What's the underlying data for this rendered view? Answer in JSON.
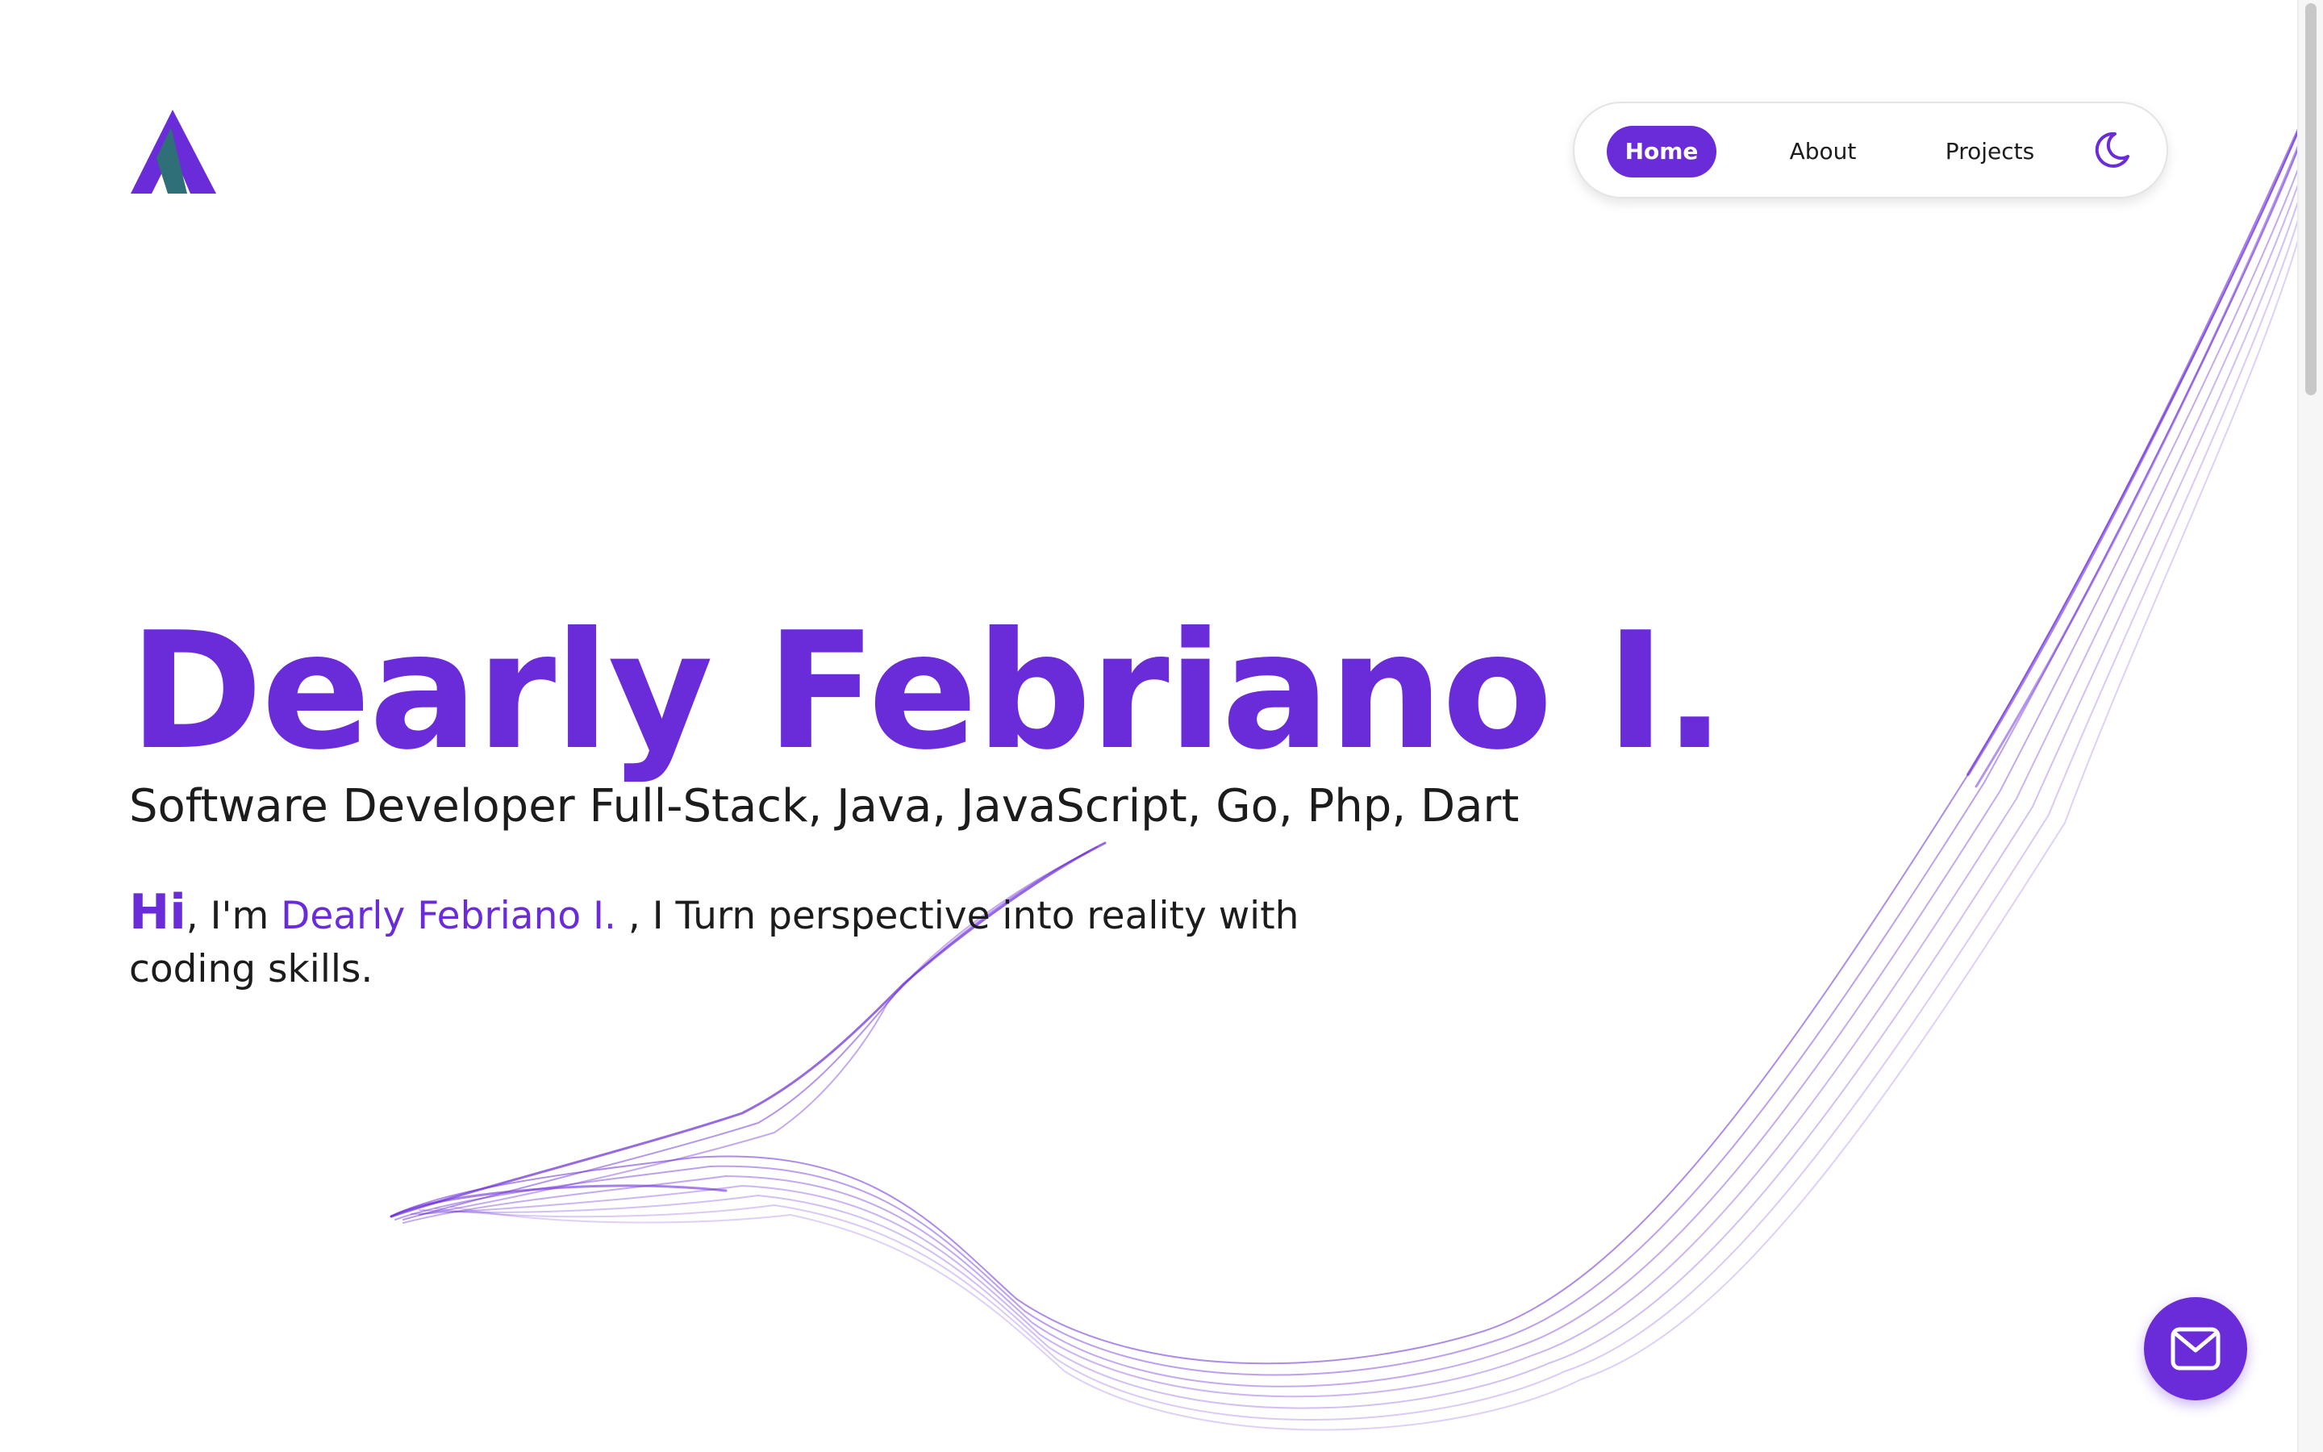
{
  "logo": {
    "icon": "a-monogram-logo"
  },
  "nav": {
    "items": [
      {
        "label": "Home",
        "active": true
      },
      {
        "label": "About",
        "active": false
      },
      {
        "label": "Projects",
        "active": false
      }
    ],
    "theme_icon": "moon-icon"
  },
  "hero": {
    "title": "Dearly Febriano I.",
    "subtitle": "Software Developer Full-Stack, Java, JavaScript, Go, Php, Dart",
    "intro": {
      "greeting": "Hi",
      "im": ", I'm ",
      "name": "Dearly Febriano I.",
      "rest": " , I Turn perspective into reality with coding skills."
    }
  },
  "contact": {
    "icon": "mail-icon"
  },
  "colors": {
    "accent": "#6a2bd9",
    "logo_teal": "#2f6f78",
    "text": "#1c1c1c",
    "background": "#ffffff"
  }
}
